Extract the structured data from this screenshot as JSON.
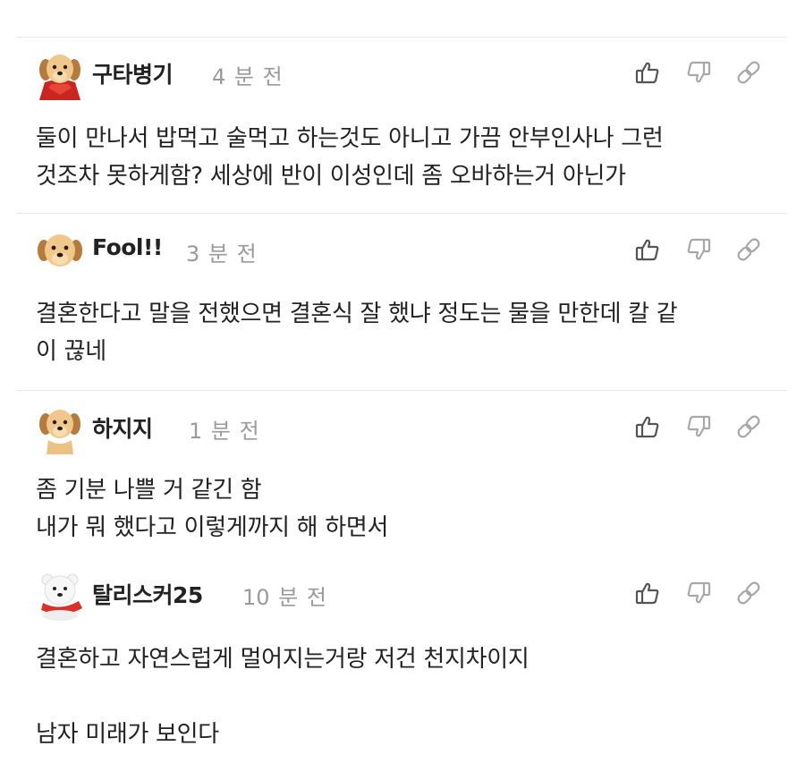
{
  "comments": [
    {
      "username": "구타병기",
      "time": "4 분 전",
      "avatar": "puppy-red-cape-icon",
      "lines": [
        "둘이 만나서 밥먹고 술먹고 하는것도 아니고 가끔 안부인사나 그런",
        "것조차 못하게함? 세상에 반이 이성인데 좀 오바하는거 아닌가"
      ]
    },
    {
      "username": "Fool!!",
      "time": "3 분 전",
      "avatar": "puppy-face-icon",
      "lines": [
        "결혼한다고 말을 전했으면 결혼식 잘 했냐 정도는 물을 만한데 칼 같",
        "이 끊네"
      ]
    },
    {
      "username": "하지지",
      "time": "1 분 전",
      "avatar": "puppy-face-icon",
      "lines": [
        "좀 기분 나쁠 거 같긴 함",
        "내가 뭐 했다고 이렇게까지 해 하면서"
      ]
    },
    {
      "username": "탈리스커25",
      "time": "10 분 전",
      "avatar": "polar-bear-red-scarf-icon",
      "lines": [
        "결혼하고 자연스럽게 멀어지는거랑 저건 천지차이지",
        "",
        "남자 미래가 보인다"
      ]
    }
  ],
  "icons": {
    "like": "thumbs-up-icon",
    "dislike": "thumbs-down-icon",
    "share": "link-icon"
  },
  "colors": {
    "text": "#222222",
    "meta": "#9a9a9a",
    "icon": "#555555",
    "icon_muted": "#a8a8a8",
    "divider": "#e6e6e6"
  }
}
